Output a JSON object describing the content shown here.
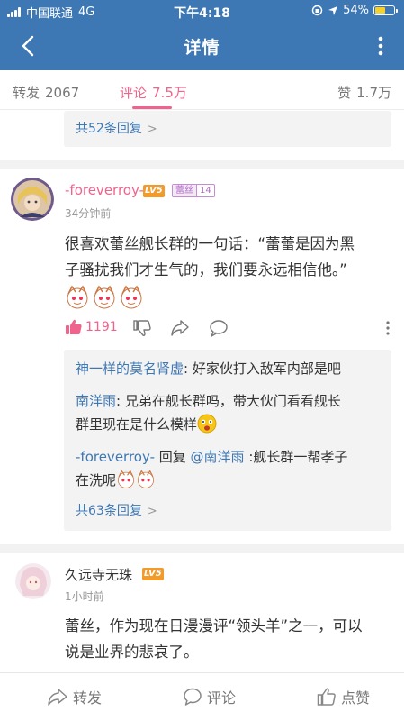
{
  "status_bar": {
    "carrier": "中国联通",
    "network": "4G",
    "time": "下午4:18",
    "battery_percent": "54%",
    "battery_level": 0.54
  },
  "nav": {
    "title": "详情"
  },
  "tabs": [
    {
      "label": "转发",
      "count": "2067"
    },
    {
      "label": "评论",
      "count": "7.5万",
      "active": true
    },
    {
      "label": "赞",
      "count": "1.7万"
    }
  ],
  "top_thread": {
    "more_replies": "共52条回复"
  },
  "comments": [
    {
      "username": "-foreverroy-",
      "level_badge": "LV5",
      "fan_badge": {
        "name": "蕾丝",
        "level": "14"
      },
      "time": "34分钟前",
      "text_line1": "很喜欢蕾丝舰长群的一句话：“蕾蕾是因为黑",
      "text_line2": "子骚扰我们才生气的，我们要永远相信他。”",
      "like_count": "1191",
      "replies": {
        "r1_user": "神一样的莫名肾虚",
        "r1_text": ": 好家伙打入敌军内部是吧",
        "r2_user": "南洋雨",
        "r2_text_a": ": 兄弟在舰长群吗，带大伙门看看舰长",
        "r2_text_b": "群里现在是什么模样",
        "r3_user": "-foreverroy-",
        "r3_mid": " 回复 ",
        "r3_mention": "@南洋雨",
        "r3_text_a": " :舰长群一帮孝子",
        "r3_text_b": "在洗呢",
        "more": "共63条回复"
      }
    },
    {
      "username": "久远寺无珠",
      "level_badge": "LV5",
      "time": "1小时前",
      "text_line1": "蕾丝，作为现在日漫漫评“领头羊”之一，可以",
      "text_line2": "说是业界的悲哀了。"
    }
  ],
  "bottom_bar": {
    "repost": "转发",
    "comment": "评论",
    "like": "点赞"
  },
  "colors": {
    "brand": "#3E78B4",
    "accent_pink": "#F0638C",
    "level_badge": "#F29B2A"
  }
}
